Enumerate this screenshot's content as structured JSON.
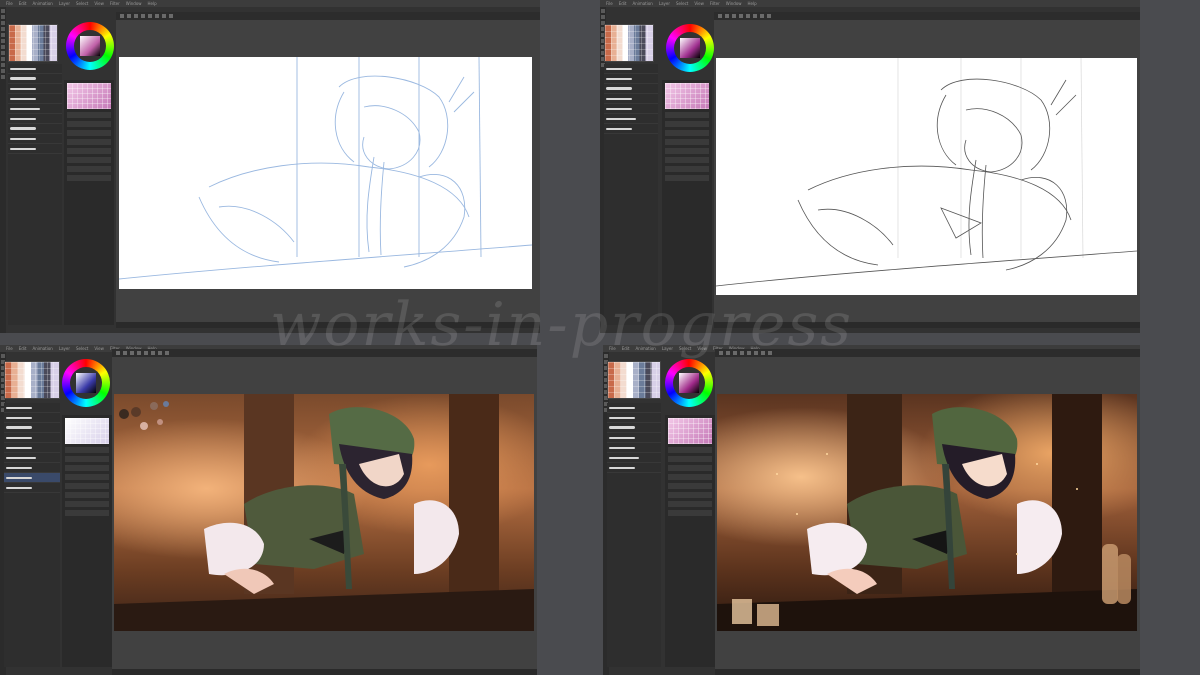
{
  "watermark": "works-in-progress",
  "menu_items": [
    "File",
    "Edit",
    "Animation",
    "Layer",
    "Select",
    "View",
    "Filter",
    "Window",
    "Help"
  ],
  "stages": [
    {
      "name": "sketch",
      "tone": "blue"
    },
    {
      "name": "lineart",
      "tone": "black"
    },
    {
      "name": "flat-color",
      "tone": "warm"
    },
    {
      "name": "final-render",
      "tone": "warm"
    }
  ],
  "colors": {
    "app_bg": "#4a4b4f",
    "panel": "#323232",
    "sketch_line": "#9ab8e0",
    "lineart": "#555555",
    "warm_light": "#f2b27a"
  }
}
